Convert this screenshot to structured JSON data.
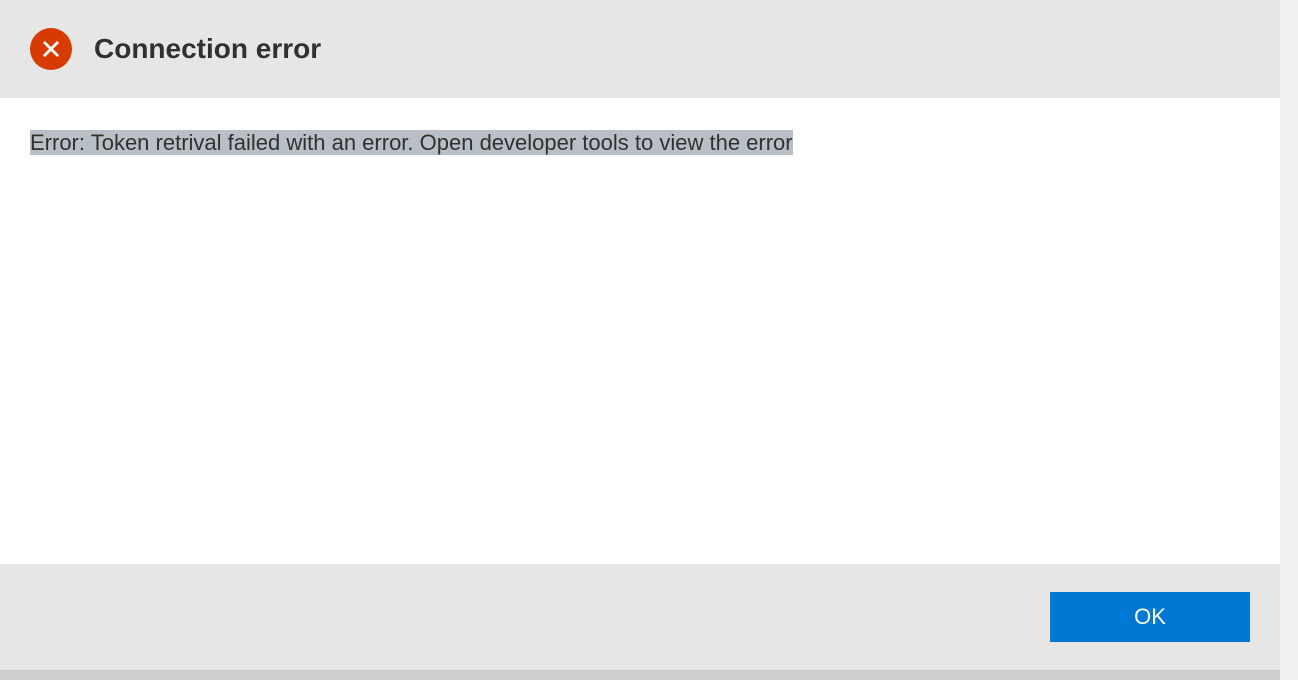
{
  "dialog": {
    "title": "Connection error",
    "message": "Error: Token retrival failed with an error. Open developer tools to view the error",
    "ok_label": "OK"
  }
}
